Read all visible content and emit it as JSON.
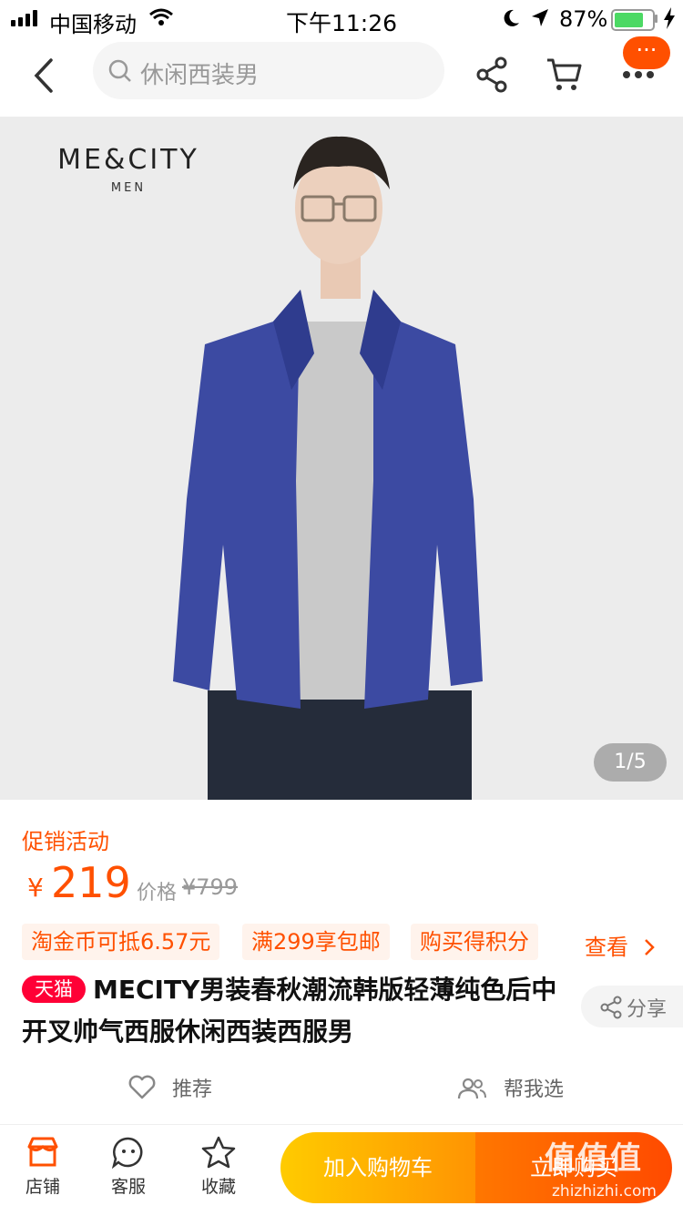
{
  "status": {
    "carrier": "中国移动",
    "time": "下午11:26",
    "battery": "87%",
    "battery_level": 0.87
  },
  "nav": {
    "search_placeholder": "休闲西装男",
    "back_icon": "chevron-left-icon",
    "share_icon": "share-icon",
    "cart_icon": "cart-icon",
    "more_icon": "more-icon",
    "badge": "···"
  },
  "hero": {
    "brand_main": "ME&CITY",
    "brand_sub": "MEN",
    "counter": "1/5",
    "colors": {
      "jacket": "#3b4aa0",
      "tee": "#c8c8c8",
      "bg": "#ececec"
    }
  },
  "info": {
    "promo": "促销活动",
    "yen": "¥",
    "price": "219",
    "orig_label": "价格",
    "orig_price": "¥799",
    "tags": [
      "淘金币可抵6.57元",
      "满299享包邮",
      "购买得积分"
    ],
    "see_more": "查看",
    "tmall": "天猫",
    "title": "MECITY男装春秋潮流韩版轻薄纯色后中开叉帅气西服休闲西装西服男",
    "share": "分享",
    "recommend": "推荐",
    "help_choose": "帮我选"
  },
  "bottom": {
    "store": "店铺",
    "service": "客服",
    "favorite": "收藏",
    "add_cart": "加入购物车",
    "buy_now": "立即购买"
  },
  "watermark": {
    "main": "值值值",
    "sub": "zhizhizhi.com"
  },
  "accent": "#ff5000"
}
